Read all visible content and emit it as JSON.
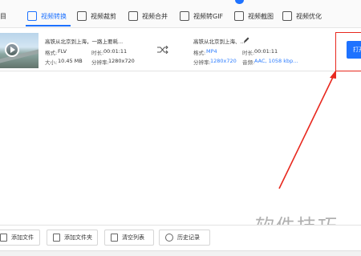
{
  "toolbar": {
    "items": [
      {
        "label": "目",
        "icon": "window-icon"
      },
      {
        "label": "视频转换",
        "icon": "video-convert-icon",
        "active": true
      },
      {
        "label": "视频裁剪",
        "icon": "video-crop-icon"
      },
      {
        "label": "视频合并",
        "icon": "video-merge-icon"
      },
      {
        "label": "视频转GIF",
        "icon": "gif-icon"
      },
      {
        "label": "视频截图",
        "icon": "screenshot-icon"
      },
      {
        "label": "视频优化",
        "icon": "optimize-icon"
      }
    ],
    "accent_color": "#1e72ff"
  },
  "file_row": {
    "source": {
      "name": "高铁从北京到上海，一路上要耗...",
      "format_label": "格式:",
      "format_value": "FLV",
      "duration_label": "时长:",
      "duration_value": "00:01:11",
      "size_label": "大小:",
      "size_value": "10.45 MB",
      "resolution_label": "分辨率:",
      "resolution_value": "1280x720"
    },
    "output": {
      "name": "高铁从北京到上海、...",
      "format_label": "格式:",
      "format_value": "MP4",
      "duration_label": "时长:",
      "duration_value": "00:01:11",
      "resolution_label": "分辨率:",
      "resolution_value": "1280x720",
      "audio_label": "音频:",
      "audio_value": "AAC, 1058 kbp..."
    },
    "open_button": "打开",
    "highlight_color": "#e8281e"
  },
  "bottom_bar": {
    "add_file": "添加文件",
    "add_folder": "添加文件夹",
    "clear_list": "清空列表",
    "history": "历史记录"
  },
  "watermark": "软件技巧"
}
